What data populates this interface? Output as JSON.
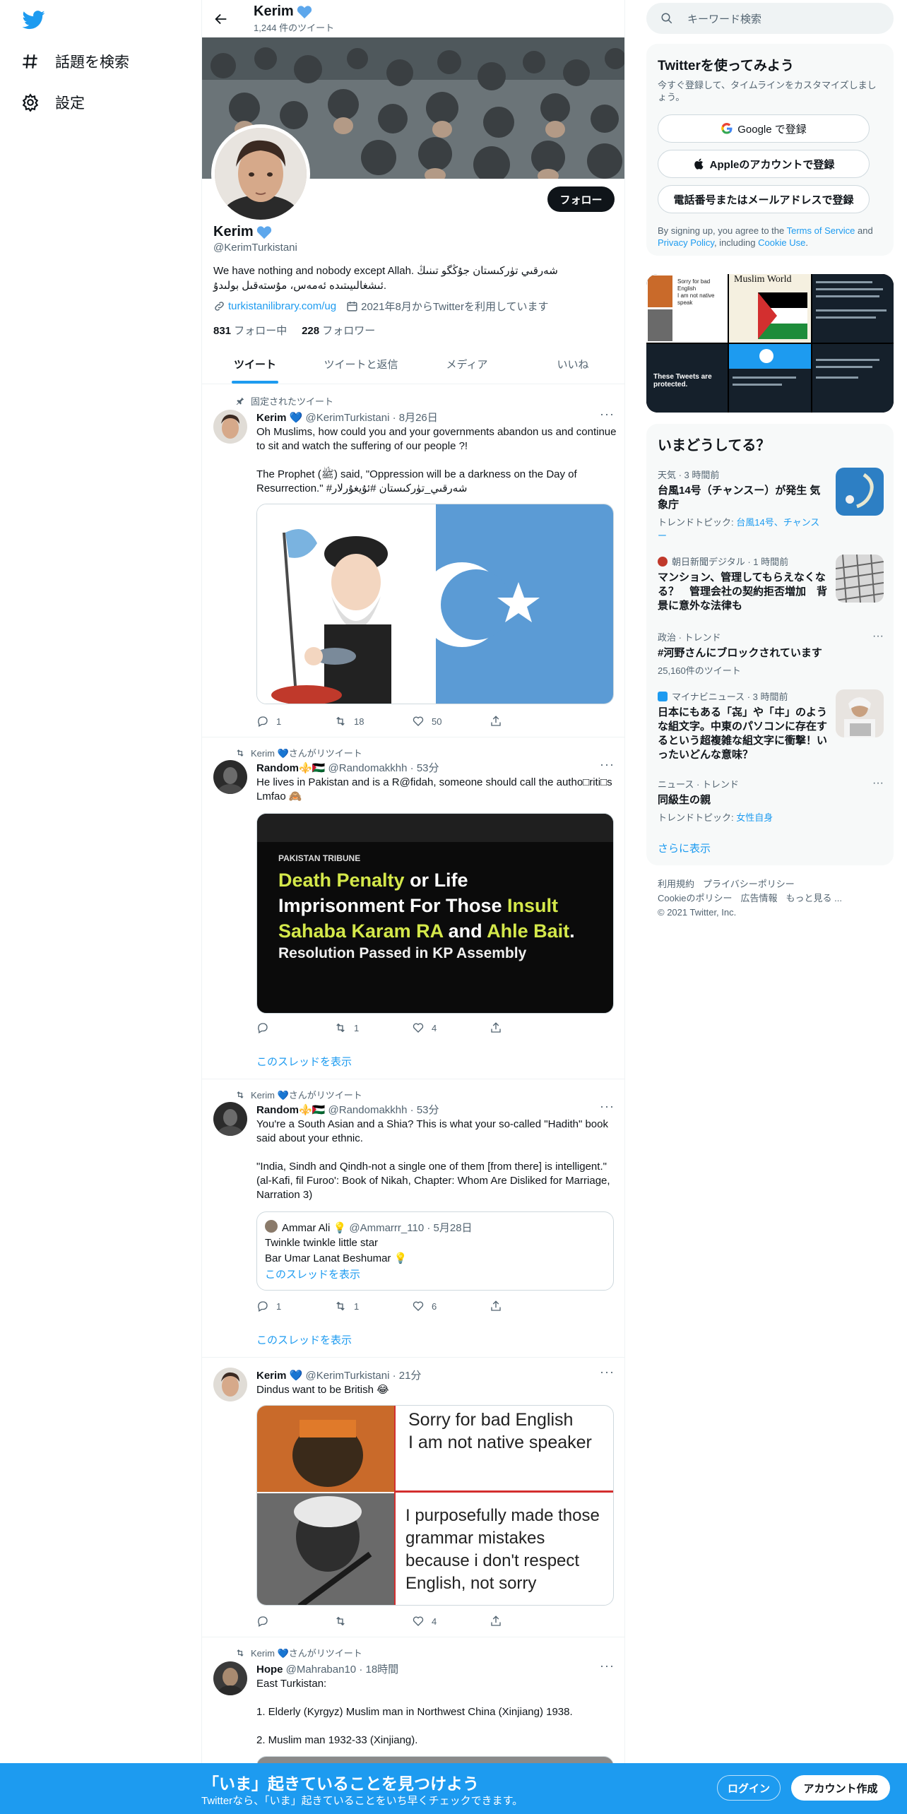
{
  "nav": {
    "explore_label": "話題を検索",
    "settings_label": "設定"
  },
  "profile": {
    "name": "Kerim",
    "tweet_count": "1,244 件のツイート",
    "handle": "@KerimTurkistani",
    "bio": "We have nothing and nobody except Allah.  شەرقىي تۈركىستان جۇڭگو تىنىڭ ئىشغالىيىتىدە ئەمەس، مۇستەقىل بولىدۇ.",
    "website": "turkistanilibrary.com/ug",
    "joined": "2021年8月からTwitterを利用しています",
    "following_count": "831",
    "following_label": "フォロー中",
    "followers_count": "228",
    "followers_label": "フォロワー",
    "follow_button": "フォロー"
  },
  "tabs": [
    {
      "label": "ツイート"
    },
    {
      "label": "ツイートと返信"
    },
    {
      "label": "メディア"
    },
    {
      "label": "いいね"
    }
  ],
  "tweets": [
    {
      "social": "固定されたツイート",
      "name": "Kerim 💙",
      "handle": "@KerimTurkistani",
      "time": "· 8月26日",
      "text": "Oh Muslims, how could you and your governments abandon us and continue to sit and watch the suffering of our people ?!\n\nThe Prophet (ﷺ) said, \"Oppression will be a darkness on the Day of Resurrection.\" #شەرقىي_تۈركىستان #ئۇيغۇرلار",
      "replies": "1",
      "retweets": "18",
      "likes": "50"
    },
    {
      "social": "Kerim 💙さんがリツイート",
      "name": "Random⚜️🇵🇸",
      "handle": "@Randomakkhh",
      "time": "· 53分",
      "text": "He lives in Pakistan and is a R@fidah, someone should call the autho□riti□s Lmfao 🙈",
      "media_caption_source": "PAKISTAN TRIBUNE",
      "media_line1a": "Death Penalty",
      "media_line1b": " or Life",
      "media_line2a": "Imprisonment For Those ",
      "media_line2b": "Insult",
      "media_line3a": "Sahaba Karam RA",
      "media_line3b": " and ",
      "media_line3c": "Ahle Bait",
      "media_line3d": ".",
      "media_line4": "Resolution Passed in KP Assembly",
      "replies": "",
      "retweets": "1",
      "likes": "4",
      "thread_link": "このスレッドを表示"
    },
    {
      "social": "Kerim 💙さんがリツイート",
      "name": "Random⚜️🇵🇸",
      "handle": "@Randomakkhh",
      "time": "· 53分",
      "text": "You're a South Asian and a Shia? This is what your so-called \"Hadith\" book said about your ethnic.\n\n\"India, Sindh and Qindh-not a single one of them [from there] is intelligent.\" (al-Kafi, fil Furoo': Book of Nikah, Chapter: Whom Are Disliked for Marriage, Narration 3)",
      "quote_name": "Ammar Ali 💡",
      "quote_handle": "@Ammarrr_110",
      "quote_time": "· 5月28日",
      "quote_text": "Twinkle twinkle little star\nBar Umar Lanat Beshumar 💡",
      "quote_thread": "このスレッドを表示",
      "replies": "1",
      "retweets": "1",
      "likes": "6",
      "thread_link": "このスレッドを表示"
    },
    {
      "social": "",
      "name": "Kerim 💙",
      "handle": "@KerimTurkistani",
      "time": "· 21分",
      "text": "Dindus want to be British 😂",
      "meme_top": "Sorry for bad English\nI am not native speaker",
      "meme_bottom": "I purposefully made those grammar mistakes because i don't respect English, not sorry",
      "replies": "",
      "retweets": "",
      "likes": "4"
    },
    {
      "social": "Kerim 💙さんがリツイート",
      "name": "Hope",
      "handle": "@Mahraban10",
      "time": "· 18時間",
      "text": "East Turkistan:\n\n1. Elderly (Kyrgyz) Muslim man in Northwest China (Xinjiang) 1938.\n\n2. Muslim man 1932-33 (Xinjiang)."
    }
  ],
  "right": {
    "search_placeholder": "キーワード検索",
    "signup_title": "Twitterを使ってみよう",
    "signup_sub": "今すぐ登録して、タイムラインをカスタマイズしましょう。",
    "google_btn": "Google で登録",
    "apple_btn": "Appleのアカウントで登録",
    "phone_btn": "電話番号またはメールアドレスで登録",
    "terms_a": "By signing up, you agree to the ",
    "terms_tos": "Terms of Service",
    "terms_b": " and ",
    "terms_pp": "Privacy Policy",
    "terms_c": ", including ",
    "terms_cookie": "Cookie Use",
    "terms_d": ".",
    "grid_text_1": "Sorry for bad English\nI am not native speak",
    "grid_text_2": "Muslim World",
    "grid_text_3": "These Tweets are protected.",
    "trends_title": "いまどうしてる？",
    "trends": [
      {
        "ctx": "天気 · 3 時間前",
        "title": "台風14号（チャンスー）が発生 気象庁",
        "sub_a": "トレンドトピック: ",
        "sub_b": "台風14号、チャンス ー"
      },
      {
        "ctx": "朝日新聞デジタル · 1 時間前",
        "title": "マンション、管理してもらえなくなる？　管理会社の契約拒否増加　背景に意外な法律も"
      },
      {
        "ctx": "政治 · トレンド",
        "title": "#河野さんにブロックされています",
        "sub": "25,160件のツイート"
      },
      {
        "ctx": "マイナビニュース · 3 時間前",
        "title": "日本にもある「㐂」や「㐄」のような組文字。中東のパソコンに存在するという超複雑な組文字に衝撃！いったいどんな意味？"
      },
      {
        "ctx": "ニュース · トレンド",
        "title": "同級生の親",
        "sub_a": "トレンドトピック: ",
        "sub_b": "女性自身"
      }
    ],
    "show_more": "さらに表示",
    "footer_1": "利用規約",
    "footer_2": "プライバシーポリシー",
    "footer_3": "Cookieのポリシー",
    "footer_4": "広告情報",
    "footer_5": "もっと見る ...",
    "footer_6": "© 2021 Twitter, Inc."
  },
  "bottom": {
    "title": "「いま」起きていることを見つけよう",
    "sub": "Twitterなら、「いま」起きていることをいち早くチェックできます。",
    "login": "ログイン",
    "signup": "アカウント作成"
  },
  "colors": {
    "accent": "#1d9bf0",
    "text": "#0f1419",
    "muted": "#536471",
    "turkistan_blue": "#5b9bd5"
  }
}
